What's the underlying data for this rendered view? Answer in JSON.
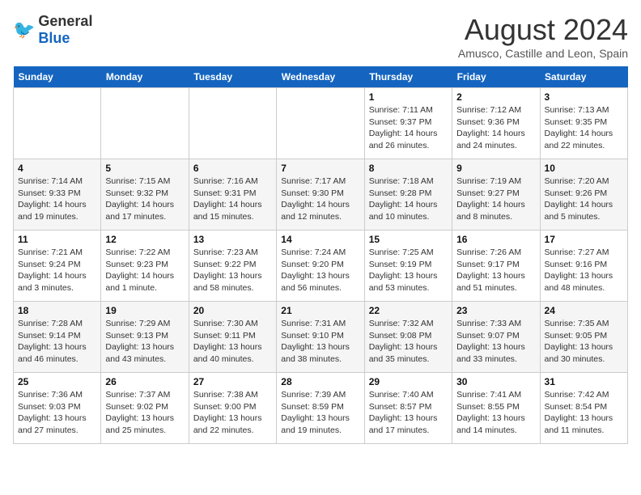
{
  "header": {
    "logo_general": "General",
    "logo_blue": "Blue",
    "month_year": "August 2024",
    "location": "Amusco, Castille and Leon, Spain"
  },
  "weekdays": [
    "Sunday",
    "Monday",
    "Tuesday",
    "Wednesday",
    "Thursday",
    "Friday",
    "Saturday"
  ],
  "weeks": [
    [
      {
        "day": "",
        "info": ""
      },
      {
        "day": "",
        "info": ""
      },
      {
        "day": "",
        "info": ""
      },
      {
        "day": "",
        "info": ""
      },
      {
        "day": "1",
        "info": "Sunrise: 7:11 AM\nSunset: 9:37 PM\nDaylight: 14 hours\nand 26 minutes."
      },
      {
        "day": "2",
        "info": "Sunrise: 7:12 AM\nSunset: 9:36 PM\nDaylight: 14 hours\nand 24 minutes."
      },
      {
        "day": "3",
        "info": "Sunrise: 7:13 AM\nSunset: 9:35 PM\nDaylight: 14 hours\nand 22 minutes."
      }
    ],
    [
      {
        "day": "4",
        "info": "Sunrise: 7:14 AM\nSunset: 9:33 PM\nDaylight: 14 hours\nand 19 minutes."
      },
      {
        "day": "5",
        "info": "Sunrise: 7:15 AM\nSunset: 9:32 PM\nDaylight: 14 hours\nand 17 minutes."
      },
      {
        "day": "6",
        "info": "Sunrise: 7:16 AM\nSunset: 9:31 PM\nDaylight: 14 hours\nand 15 minutes."
      },
      {
        "day": "7",
        "info": "Sunrise: 7:17 AM\nSunset: 9:30 PM\nDaylight: 14 hours\nand 12 minutes."
      },
      {
        "day": "8",
        "info": "Sunrise: 7:18 AM\nSunset: 9:28 PM\nDaylight: 14 hours\nand 10 minutes."
      },
      {
        "day": "9",
        "info": "Sunrise: 7:19 AM\nSunset: 9:27 PM\nDaylight: 14 hours\nand 8 minutes."
      },
      {
        "day": "10",
        "info": "Sunrise: 7:20 AM\nSunset: 9:26 PM\nDaylight: 14 hours\nand 5 minutes."
      }
    ],
    [
      {
        "day": "11",
        "info": "Sunrise: 7:21 AM\nSunset: 9:24 PM\nDaylight: 14 hours\nand 3 minutes."
      },
      {
        "day": "12",
        "info": "Sunrise: 7:22 AM\nSunset: 9:23 PM\nDaylight: 14 hours\nand 1 minute."
      },
      {
        "day": "13",
        "info": "Sunrise: 7:23 AM\nSunset: 9:22 PM\nDaylight: 13 hours\nand 58 minutes."
      },
      {
        "day": "14",
        "info": "Sunrise: 7:24 AM\nSunset: 9:20 PM\nDaylight: 13 hours\nand 56 minutes."
      },
      {
        "day": "15",
        "info": "Sunrise: 7:25 AM\nSunset: 9:19 PM\nDaylight: 13 hours\nand 53 minutes."
      },
      {
        "day": "16",
        "info": "Sunrise: 7:26 AM\nSunset: 9:17 PM\nDaylight: 13 hours\nand 51 minutes."
      },
      {
        "day": "17",
        "info": "Sunrise: 7:27 AM\nSunset: 9:16 PM\nDaylight: 13 hours\nand 48 minutes."
      }
    ],
    [
      {
        "day": "18",
        "info": "Sunrise: 7:28 AM\nSunset: 9:14 PM\nDaylight: 13 hours\nand 46 minutes."
      },
      {
        "day": "19",
        "info": "Sunrise: 7:29 AM\nSunset: 9:13 PM\nDaylight: 13 hours\nand 43 minutes."
      },
      {
        "day": "20",
        "info": "Sunrise: 7:30 AM\nSunset: 9:11 PM\nDaylight: 13 hours\nand 40 minutes."
      },
      {
        "day": "21",
        "info": "Sunrise: 7:31 AM\nSunset: 9:10 PM\nDaylight: 13 hours\nand 38 minutes."
      },
      {
        "day": "22",
        "info": "Sunrise: 7:32 AM\nSunset: 9:08 PM\nDaylight: 13 hours\nand 35 minutes."
      },
      {
        "day": "23",
        "info": "Sunrise: 7:33 AM\nSunset: 9:07 PM\nDaylight: 13 hours\nand 33 minutes."
      },
      {
        "day": "24",
        "info": "Sunrise: 7:35 AM\nSunset: 9:05 PM\nDaylight: 13 hours\nand 30 minutes."
      }
    ],
    [
      {
        "day": "25",
        "info": "Sunrise: 7:36 AM\nSunset: 9:03 PM\nDaylight: 13 hours\nand 27 minutes."
      },
      {
        "day": "26",
        "info": "Sunrise: 7:37 AM\nSunset: 9:02 PM\nDaylight: 13 hours\nand 25 minutes."
      },
      {
        "day": "27",
        "info": "Sunrise: 7:38 AM\nSunset: 9:00 PM\nDaylight: 13 hours\nand 22 minutes."
      },
      {
        "day": "28",
        "info": "Sunrise: 7:39 AM\nSunset: 8:59 PM\nDaylight: 13 hours\nand 19 minutes."
      },
      {
        "day": "29",
        "info": "Sunrise: 7:40 AM\nSunset: 8:57 PM\nDaylight: 13 hours\nand 17 minutes."
      },
      {
        "day": "30",
        "info": "Sunrise: 7:41 AM\nSunset: 8:55 PM\nDaylight: 13 hours\nand 14 minutes."
      },
      {
        "day": "31",
        "info": "Sunrise: 7:42 AM\nSunset: 8:54 PM\nDaylight: 13 hours\nand 11 minutes."
      }
    ]
  ]
}
